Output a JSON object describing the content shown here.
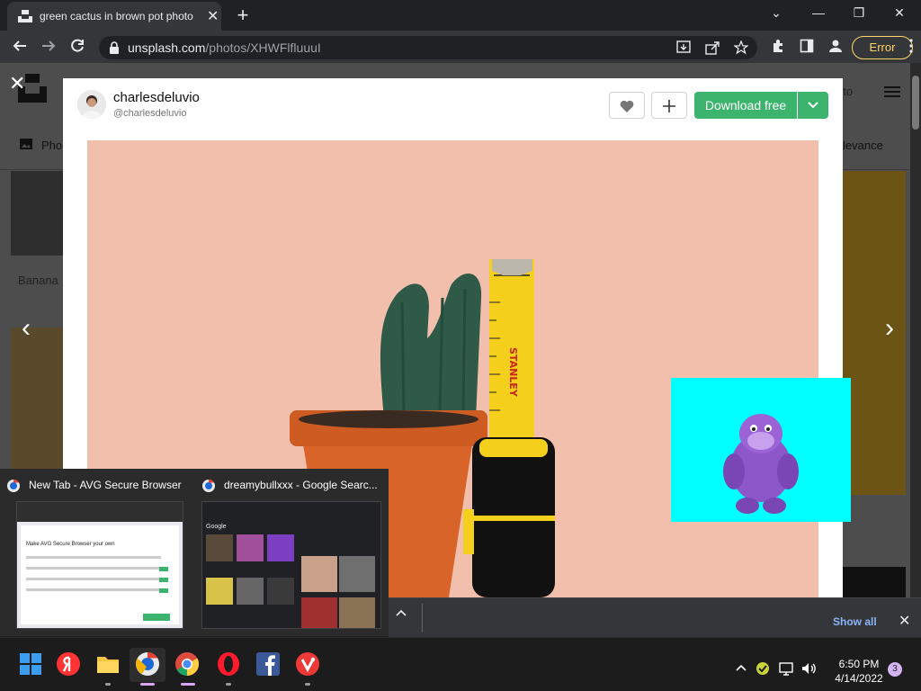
{
  "browser": {
    "tab_title": "green cactus in brown pot photo",
    "url_domain": "unsplash.com",
    "url_path": "/photos/XHWFlfluuuI",
    "error_label": "Error",
    "new_tab_symbol": "+",
    "close_tab_symbol": "✕",
    "window_minimize": "—",
    "window_restore": "❐",
    "window_close": "✕",
    "tab_search_symbol": "⌄"
  },
  "background_page": {
    "nav_photos_label": "Pho",
    "nav_relevance_label": "levance",
    "tile_label": "Banana",
    "snippet_label": "oto"
  },
  "modal": {
    "username": "charlesdeluvio",
    "handle": "@charlesdeluvio",
    "download_label": "Download free",
    "close_symbol": "✕",
    "prev_symbol": "‹",
    "next_symbol": "›"
  },
  "photo": {
    "tape_brand": "STANLEY"
  },
  "taskbar_previews": [
    {
      "title": "New Tab - AVG Secure Browser",
      "preview_heading": "Make AVG Secure Browser your own"
    },
    {
      "title": "dreamybullxxx - Google Searc...",
      "preview_heading": "Google"
    }
  ],
  "downloads_bar": {
    "show_all_label": "Show all",
    "close_symbol": "✕"
  },
  "taskbar": {
    "time": "6:50 PM",
    "date": "4/14/2022",
    "notification_count": "3",
    "apps": [
      "windows-start",
      "yandex-browser",
      "file-explorer",
      "avg-secure-browser",
      "google-chrome",
      "opera",
      "facebook",
      "vivaldi"
    ]
  },
  "colors": {
    "download_green": "#3cb46e",
    "error_yellow": "#fdd663",
    "photo_background": "#f2bfac",
    "overlay_cyan": "#00ffff"
  }
}
